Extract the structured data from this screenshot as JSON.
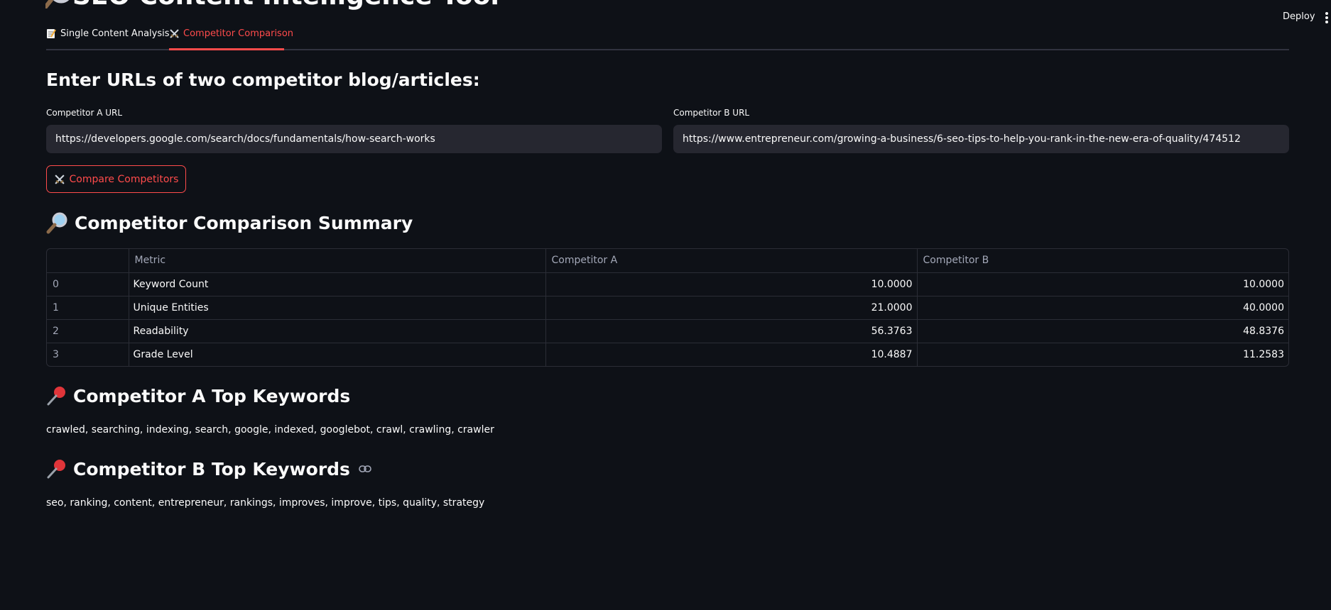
{
  "app": {
    "title": "SEO Content Intelligence Tool",
    "title_icon": "magnifier-icon",
    "deploy_label": "Deploy",
    "menu_icon": "kebab-menu-icon"
  },
  "tabs": [
    {
      "label": "Single Content Analysis",
      "icon": "memo-icon",
      "active": false
    },
    {
      "label": "Competitor Comparison",
      "icon": "crossed-swords-icon",
      "active": true
    }
  ],
  "form": {
    "heading": "Enter URLs of two competitor blog/articles:",
    "competitor_a": {
      "label": "Competitor A URL",
      "value": "https://developers.google.com/search/docs/fundamentals/how-search-works"
    },
    "competitor_b": {
      "label": "Competitor B URL",
      "value": "https://www.entrepreneur.com/growing-a-business/6-seo-tips-to-help-you-rank-in-the-new-era-of-quality/474512"
    },
    "compare_button": {
      "label": "Compare Competitors",
      "icon": "crossed-swords-icon"
    }
  },
  "summary": {
    "heading": "Competitor Comparison Summary",
    "icon": "magnifier-icon",
    "columns": [
      "",
      "Metric",
      "Competitor A",
      "Competitor B"
    ],
    "rows": [
      {
        "index": "0",
        "metric": "Keyword Count",
        "a": "10.0000",
        "b": "10.0000"
      },
      {
        "index": "1",
        "metric": "Unique Entities",
        "a": "21.0000",
        "b": "40.0000"
      },
      {
        "index": "2",
        "metric": "Readability",
        "a": "56.3763",
        "b": "48.8376"
      },
      {
        "index": "3",
        "metric": "Grade Level",
        "a": "10.4887",
        "b": "11.2583"
      }
    ]
  },
  "keywords_a": {
    "heading": "Competitor A Top Keywords",
    "icon": "pushpin-icon",
    "text": "crawled, searching, indexing, search, google, indexed, googlebot, crawl, crawling, crawler"
  },
  "keywords_b": {
    "heading": "Competitor B Top Keywords",
    "icon": "pushpin-icon",
    "link_icon": "link-icon",
    "text": "seo, ranking, content, entrepreneur, rankings, improves, improve, tips, quality, strategy"
  },
  "colors": {
    "background": "#0e1117",
    "input_bg": "#262730",
    "accent": "#ff4b4b",
    "text": "#fafafa",
    "muted": "#a3a8b8",
    "border": "#2b2d36"
  }
}
